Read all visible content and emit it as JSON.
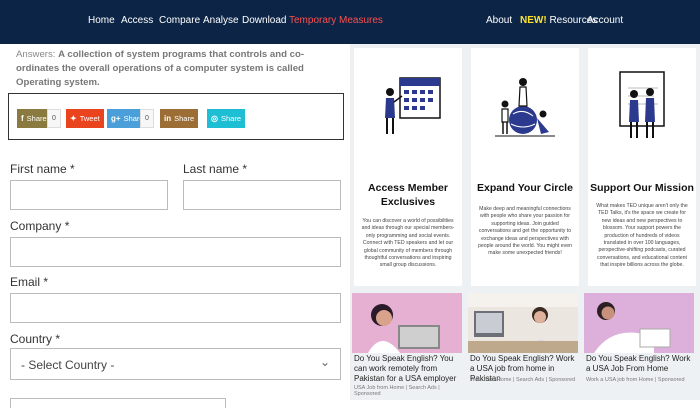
{
  "nav": {
    "items": [
      "Home",
      "Access",
      "Compare",
      "Analyse",
      "Download",
      "Temporary Measures"
    ],
    "right": [
      "About",
      "Resources",
      "Account"
    ],
    "new_badge": "NEW!"
  },
  "answer": {
    "prefix": "Answers: ",
    "text": "A collection of system programs that controls and co-ordinates the overall operations of a computer system is called Operating system."
  },
  "share": {
    "facebook": "Share",
    "facebook_count": "0",
    "twitter": "Tweet",
    "google": "Share",
    "google_count": "0",
    "linkedin": "Share",
    "stumble": "Share"
  },
  "form": {
    "first_name": "First name *",
    "last_name": "Last name *",
    "company": "Company *",
    "email": "Email *",
    "country": "Country *",
    "country_placeholder": "- Select Country -"
  },
  "cards": [
    {
      "title": "Access Member Exclusives",
      "text": "You can discover a world of possibilities and ideas through our special members-only programming and social events. Connect with TED speakers and let our global community of members through thoughtful conversations and inspiring small group discussions."
    },
    {
      "title": "Expand Your Circle",
      "text": "Make deep and meaningful connections with people who share your passion for supporting ideas. Join guided conversations and get the opportunity to exchange ideas and perspectives with people around the world. You might even make some unexpected friends!"
    },
    {
      "title": "Support Our Mission",
      "text": "What makes TED unique aren't only the TED Talks, it's the space we create for new ideas and new perspectives to blossom. Your support powers the production of hundreds of videos translated in over 100 languages, perspective-shifting podcasts, curated conversations, and educational content that inspire billions across the globe."
    }
  ],
  "ads": [
    {
      "title": "Do You Speak English? You can work remotely from Pakistan for a USA employer",
      "source": "USA Job from Home | Search Ads | Sponsored"
    },
    {
      "title": "Do You Speak English? Work a USA job from home in Pakistan",
      "source": "Work from Home | Search Ads | Sponsored"
    },
    {
      "title": "Do You Speak English? Work a USA Job From Home",
      "source": "Work a USA job from Home | Sponsored"
    }
  ]
}
